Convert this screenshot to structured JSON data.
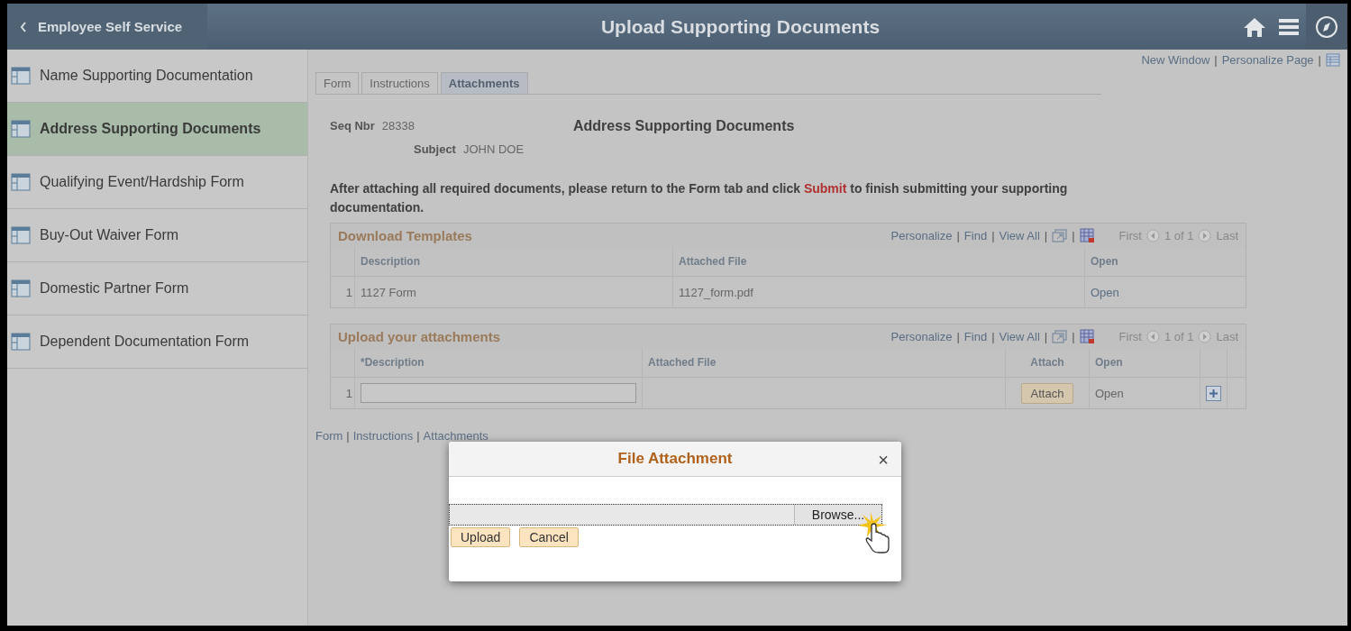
{
  "header": {
    "back_label": "Employee Self Service",
    "title": "Upload Supporting Documents"
  },
  "sidebar": {
    "items": [
      {
        "label": "Name Supporting Documentation",
        "selected": false
      },
      {
        "label": "Address Supporting Documents",
        "selected": true
      },
      {
        "label": "Qualifying Event/Hardship Form",
        "selected": false
      },
      {
        "label": "Buy-Out Waiver Form",
        "selected": false
      },
      {
        "label": "Domestic Partner Form",
        "selected": false
      },
      {
        "label": "Dependent Documentation Form",
        "selected": false
      }
    ]
  },
  "top_links": [
    {
      "kind": "link",
      "text": "New Window"
    },
    {
      "kind": "separator",
      "text": "|"
    },
    {
      "kind": "link",
      "text": "Personalize Page"
    },
    {
      "kind": "separator",
      "text": "|"
    },
    {
      "kind": "grid_icon"
    }
  ],
  "tabs": [
    {
      "label": "Form",
      "selected": false
    },
    {
      "label": "Instructions",
      "selected": false
    },
    {
      "label": "Attachments",
      "selected": true
    }
  ],
  "record": {
    "seq_label": "Seq Nbr",
    "seq_value": "28338",
    "subject_label": "Subject",
    "subject_value": "JOHN DOE",
    "page_title": "Address Supporting Documents"
  },
  "instruction": {
    "before": "After attaching all required documents, please return to the Form tab and click",
    "link": "Submit",
    "after": "to finish submitting your supporting documentation."
  },
  "download_grid": {
    "title": "Download Templates",
    "tools": [
      {
        "kind": "link",
        "text": "Personalize"
      },
      {
        "kind": "separator",
        "text": "|"
      },
      {
        "kind": "link",
        "text": "Find"
      },
      {
        "kind": "separator",
        "text": "|"
      },
      {
        "kind": "link",
        "text": "View All"
      },
      {
        "kind": "separator",
        "text": "|"
      },
      {
        "kind": "new_window_icon"
      },
      {
        "kind": "separator",
        "text": "|"
      },
      {
        "kind": "spreadsheet_icon"
      }
    ],
    "first": "First",
    "count": "1 of 1",
    "last": "Last",
    "columns": [
      "Description",
      "Attached File",
      "Open"
    ],
    "rows": [
      {
        "num": "1",
        "description": "1127 Form",
        "file": "1127_form.pdf",
        "open": "Open"
      }
    ]
  },
  "upload_grid": {
    "title": "Upload your attachments",
    "tools": [
      {
        "kind": "link",
        "text": "Personalize"
      },
      {
        "kind": "separator",
        "text": "|"
      },
      {
        "kind": "link",
        "text": "Find"
      },
      {
        "kind": "separator",
        "text": "|"
      },
      {
        "kind": "link",
        "text": "View All"
      },
      {
        "kind": "separator",
        "text": "|"
      },
      {
        "kind": "new_window_icon"
      },
      {
        "kind": "separator",
        "text": "|"
      },
      {
        "kind": "spreadsheet_icon"
      }
    ],
    "first": "First",
    "count": "1 of 1",
    "last": "Last",
    "columns": [
      "*Description",
      "Attached File",
      "Attach",
      "Open"
    ],
    "rows": [
      {
        "num": "1",
        "attach": "Attach",
        "open": "Open"
      }
    ]
  },
  "bottom_links": [
    {
      "kind": "link",
      "text": "Form"
    },
    {
      "kind": "separator",
      "text": "|"
    },
    {
      "kind": "link",
      "text": "Instructions"
    },
    {
      "kind": "separator",
      "text": "|"
    },
    {
      "kind": "link",
      "text": "Attachments"
    }
  ],
  "dialog": {
    "title": "File Attachment",
    "close": "×",
    "browse": "Browse...",
    "buttons": [
      "Upload",
      "Cancel"
    ]
  }
}
